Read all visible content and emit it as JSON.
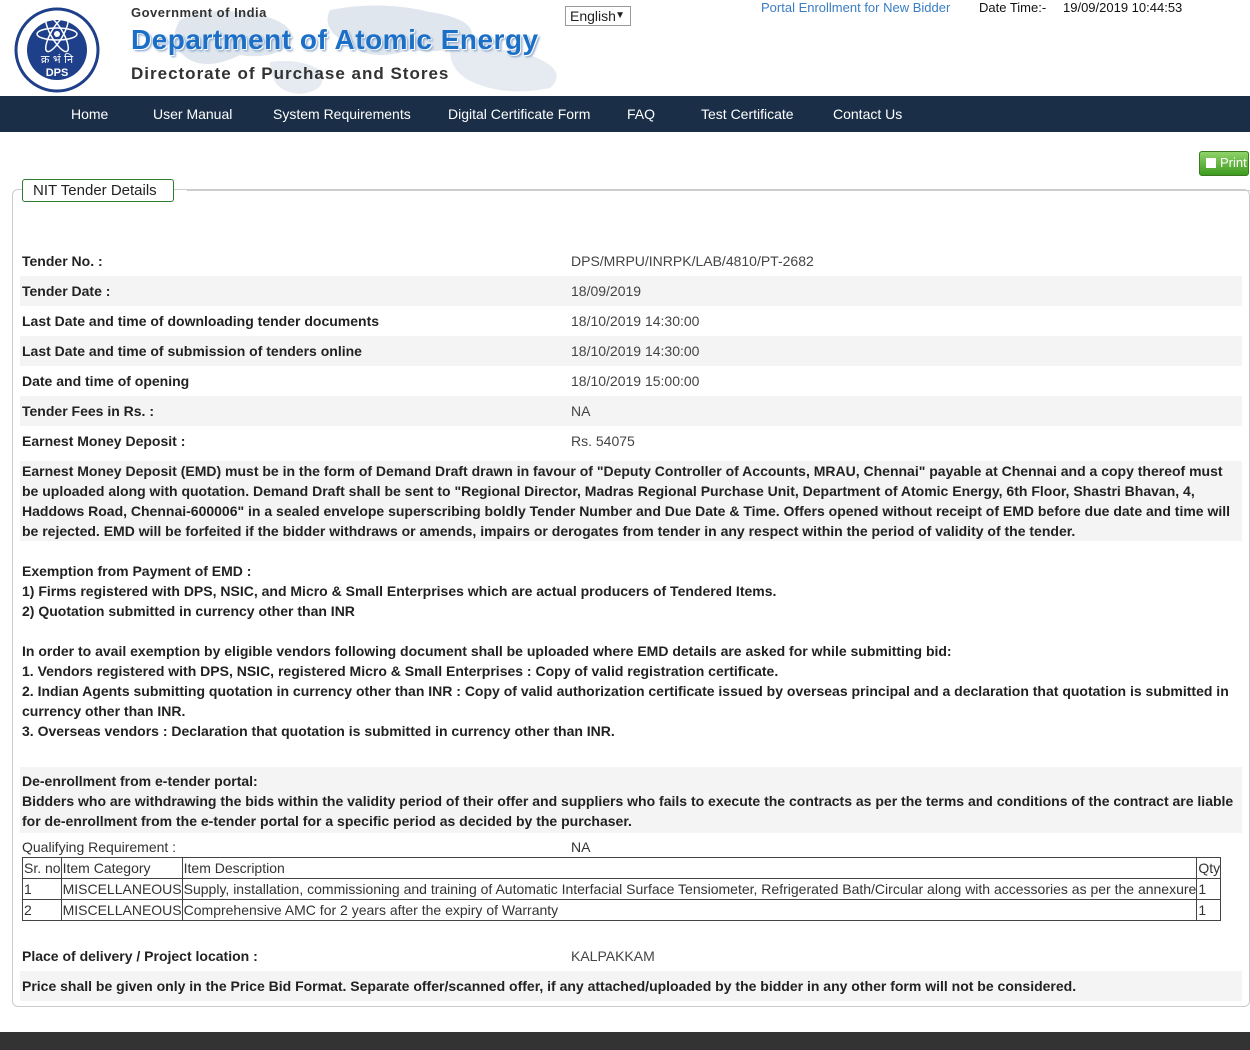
{
  "header": {
    "gov": "Government of India",
    "dept": "Department of Atomic Energy",
    "dir": "Directorate of Purchase and Stores",
    "logo_text_hindi": "क्र भं नि",
    "logo_text": "DPS",
    "logo_ring_top": "राष्ट्र की सेवा में परमाणु",
    "logo_ring_bottom": "ATOMS IN THE SERVICE OF THE NATION",
    "language": "English",
    "enroll_link": "Portal Enrollment for New Bidder",
    "datetime_label": "Date Time:-",
    "datetime_value": "19/09/2019 10:44:53"
  },
  "nav": [
    "Home",
    "User Manual",
    "System Requirements",
    "Digital Certificate Form",
    "FAQ",
    "Test Certificate",
    "Contact Us"
  ],
  "print_label": "Print",
  "section_title": "NIT Tender Details",
  "details": [
    {
      "label": "Tender No. :",
      "value": "DPS/MRPU/INRPK/LAB/4810/PT-2682"
    },
    {
      "label": "Tender Date :",
      "value": "18/09/2019"
    },
    {
      "label": "Last Date and time of downloading tender documents",
      "value": "18/10/2019 14:30:00"
    },
    {
      "label": "Last Date and time of submission of tenders online",
      "value": "18/10/2019 14:30:00"
    },
    {
      "label": "Date and time of opening",
      "value": "18/10/2019 15:00:00"
    },
    {
      "label": "Tender Fees in Rs. :",
      "value": "NA"
    },
    {
      "label": "Earnest Money Deposit :",
      "value": "Rs. 54075"
    }
  ],
  "emd_text": "Earnest Money Deposit (EMD) must be in the form of Demand Draft drawn in favour of \"Deputy Controller of Accounts, MRAU, Chennai\" payable at Chennai and a copy thereof must be uploaded along with quotation. Demand Draft shall be sent to \"Regional Director, Madras Regional Purchase Unit, Department of Atomic Energy, 6th Floor, Shastri Bhavan, 4, Haddows Road, Chennai-600006\" in a sealed envelope superscribing boldly Tender Number and Due Date & Time. Offers opened without receipt of EMD before due date and time will be rejected. EMD will be forfeited if the bidder withdraws or amends, impairs or derogates from tender in any respect within the period of validity of the tender.",
  "exemption": {
    "title": "Exemption from Payment of EMD :",
    "items": [
      "1) Firms registered with DPS, NSIC, and Micro & Small Enterprises which are actual producers of Tendered Items.",
      "2) Quotation submitted in currency other than INR"
    ]
  },
  "avail": {
    "title": "In order to avail exemption by eligible vendors following document shall be uploaded where EMD details are asked for while submitting bid:",
    "items": [
      "1. Vendors registered with DPS, NSIC, registered Micro & Small Enterprises : Copy of valid registration certificate.",
      "2. Indian Agents submitting quotation in currency other than INR : Copy of valid authorization certificate issued by overseas principal and a declaration that quotation is submitted in currency other than INR.",
      "3. Overseas vendors : Declaration that quotation is submitted in currency other than INR."
    ]
  },
  "deenroll": {
    "title": "De-enrollment from e-tender portal:",
    "text": "Bidders who are withdrawing the bids within the validity period of their offer and suppliers who fails to execute the contracts as per the terms and conditions of the contract are liable for de-enrollment from the e-tender portal for a specific period as decided by the purchaser."
  },
  "qualifying": {
    "label": "Qualifying Requirement :",
    "value": "NA"
  },
  "items_table": {
    "headers": [
      "Sr. no",
      "Item Category",
      "Item Description",
      "Qty"
    ],
    "rows": [
      [
        "1",
        "MISCELLANEOUS",
        "Supply, installation, commissioning and training of Automatic Interfacial Surface Tensiometer, Refrigerated Bath/Circular along with accessories as per the annexure",
        "1"
      ],
      [
        "2",
        "MISCELLANEOUS",
        "Comprehensive AMC for 2 years after the expiry of Warranty",
        "1"
      ]
    ]
  },
  "delivery": {
    "label": "Place of delivery / Project location :",
    "value": "KALPAKKAM"
  },
  "price_note": "Price shall be given only in the Price Bid Format. Separate offer/scanned offer, if any attached/uploaded by the bidder in any other form will not be considered.",
  "colors": {
    "nav_bg": "#1a2e47",
    "brand_blue": "#1b6fc6",
    "link_blue": "#3a7dc4",
    "legend_border": "#2e7d2e",
    "print_green": "#4ca82b"
  }
}
